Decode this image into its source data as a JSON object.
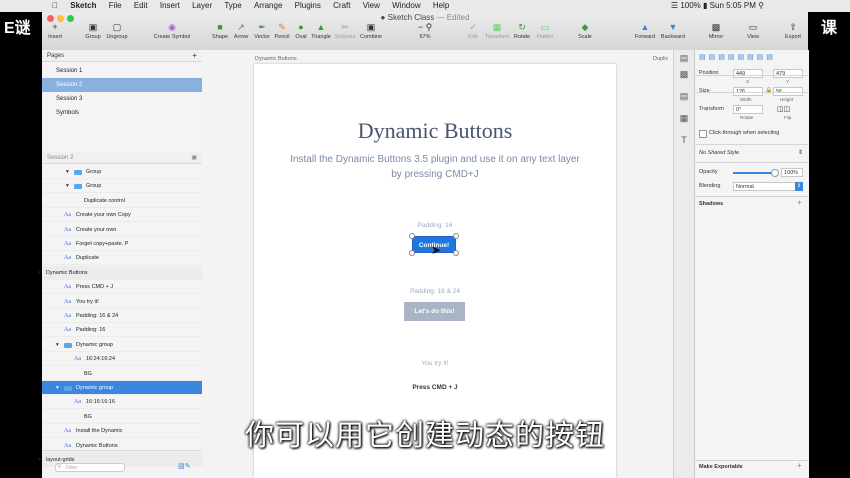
{
  "menubar": {
    "items": [
      "Sketch",
      "File",
      "Edit",
      "Insert",
      "Layer",
      "Type",
      "Arrange",
      "Plugins",
      "Craft",
      "View",
      "Window",
      "Help"
    ],
    "battery": "100%",
    "clock": "Sun 5:05 PM"
  },
  "window": {
    "title": "Sketch Class",
    "edited": "— Edited"
  },
  "toolbar": {
    "insert": "Insert",
    "group": "Group",
    "ungroup": "Ungroup",
    "create_symbol": "Create Symbol",
    "shape": "Shape",
    "arrow": "Arrow",
    "vector": "Vector",
    "pencil": "Pencil",
    "oval": "Oval",
    "triangle": "Triangle",
    "scissors": "Scissors",
    "combine": "Combine",
    "zoom": "67%",
    "edit": "Edit",
    "transform": "Transform",
    "rotate": "Rotate",
    "flatten": "Flatten",
    "scale": "Scale",
    "forward": "Forward",
    "backward": "Backward",
    "mirror": "Mirror",
    "view": "View",
    "export": "Export"
  },
  "brand": {
    "left": "E谜",
    "right": "课"
  },
  "pages": {
    "header": "Pages",
    "items": [
      "Session 1",
      "Session 2",
      "Session 3",
      "Symbols"
    ],
    "selected_index": 1
  },
  "layers": {
    "header": "Session 2",
    "rows": [
      {
        "label": "Group",
        "type": "folder",
        "indent": 1
      },
      {
        "label": "Group",
        "type": "folder",
        "indent": 1
      },
      {
        "label": "Duplicate control",
        "type": "plain",
        "indent": 2
      },
      {
        "label": "Create your own Copy",
        "type": "text",
        "indent": 0
      },
      {
        "label": "Create your own",
        "type": "text",
        "indent": 0
      },
      {
        "label": "Forget copy+paste. P",
        "type": "text",
        "indent": 0
      },
      {
        "label": "Duplicate",
        "type": "text",
        "indent": 0
      },
      {
        "label": "Dynamic Buttons",
        "type": "artboard",
        "indent": 0
      },
      {
        "label": "Press CMD + J",
        "type": "text",
        "indent": 0
      },
      {
        "label": "You try it!",
        "type": "text",
        "indent": 0
      },
      {
        "label": "Padding: 16 & 24",
        "type": "text",
        "indent": 0
      },
      {
        "label": "Padding: 16",
        "type": "text",
        "indent": 0
      },
      {
        "label": "Dynamic group",
        "type": "folder",
        "indent": 0
      },
      {
        "label": "16:24:16:24",
        "type": "text",
        "indent": 1
      },
      {
        "label": "BG",
        "type": "plain",
        "indent": 2
      },
      {
        "label": "Dynamic group",
        "type": "folder",
        "indent": 0,
        "selected": true
      },
      {
        "label": "16:16:16:16",
        "type": "text",
        "indent": 1
      },
      {
        "label": "BG",
        "type": "plain",
        "indent": 2
      },
      {
        "label": "Install the Dynamic",
        "type": "text",
        "indent": 0
      },
      {
        "label": "Dynamic Buttons",
        "type": "text",
        "indent": 0
      },
      {
        "label": "layout-grids",
        "type": "artboard",
        "indent": 0
      }
    ],
    "filter_placeholder": "Filter"
  },
  "canvas": {
    "artboard_label": "Dynamic Buttons",
    "artboard_label_2": "Duplic",
    "title": "Dynamic Buttons",
    "subtitle": "Install the Dynamic Buttons 3.5 plugin and use it on any text layer by pressing CMD+J",
    "padding1": "Padding: 16",
    "button1": "Continue!",
    "padding2": "Padding: 16 & 24",
    "button2": "Let's do this!",
    "you_try": "You try it!",
    "press_cmd": "Press CMD + J"
  },
  "caption": "你可以用它创建动态的按钮",
  "inspector": {
    "position_label": "Position",
    "x": "449",
    "y": "479",
    "x_sub": "X",
    "y_sub": "Y",
    "size_label": "Size",
    "width": "126",
    "height": "56",
    "width_sub": "Width",
    "height_sub": "Height",
    "transform_label": "Transform",
    "rotate": "0°",
    "rotate_sub": "Rotate",
    "flip_sub": "Flip",
    "click_through": "Click-through when selecting",
    "shared_style": "No Shared Style",
    "opacity_label": "Opacity",
    "opacity": "100%",
    "blending_label": "Blending",
    "blending": "Normal",
    "shadows": "Shadows",
    "make_exportable": "Make Exportable"
  },
  "colors": {
    "accent": "#1b78e0",
    "selection": "#3b86df",
    "button2": "#a9b5c6",
    "title": "#4a5470"
  }
}
